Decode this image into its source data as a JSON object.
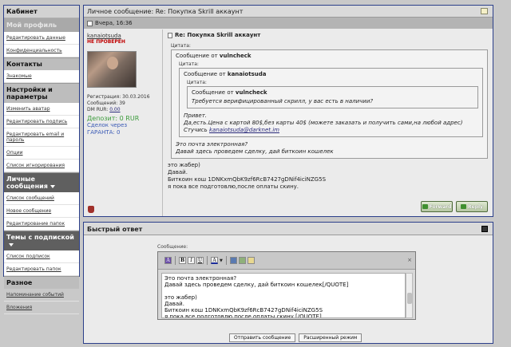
{
  "sidebar": {
    "cabinet": "Кабинет",
    "my_profile": "Мой профиль",
    "items_top": [
      "Редактировать данные",
      "Конфиденциальность"
    ],
    "contacts": "Контакты",
    "contacts_items": [
      "Знакомые"
    ],
    "settings": "Настройки и параметры",
    "settings_items": [
      "Изменить аватар",
      "Редактировать подпись",
      "Редактировать email и пароль",
      "Опции",
      "Список игнорирования"
    ],
    "pm": "Личные сообщения",
    "pm_items": [
      "Список сообщений",
      "Новое сообщение",
      "Редактирование папок"
    ],
    "subs": "Темы с подпиской",
    "subs_items": [
      "Список подписок",
      "Редактировать папок"
    ],
    "misc": "Разное",
    "misc_items": [
      "Напоминание событий",
      "Вложения"
    ]
  },
  "message": {
    "header_label": "Личное сообщение:",
    "header_subject": "Re: Покупка Skrill аккаунт",
    "date": "Вчера, 16:36",
    "author_name": "kanaiotsuda",
    "author_status": "НЕ ПРОВЕРЕН",
    "reg": "Регистрация: 30.03.2016",
    "posts": "Сообщений: 39",
    "dm_label": "DM RUR: ",
    "dm_value": "0.00",
    "deposit": "Депозит: 0 RUR",
    "escrow1": "Сделок через",
    "escrow2": "ГАРАНТА: 0",
    "title": "Re: Покупка Skrill аккаунт",
    "quote_label": "Цитата:",
    "q1_from_prefix": "Сообщение от ",
    "q1_from": "vulncheck",
    "q2_from": "kanaiotsuda",
    "q3_from": "vulncheck",
    "q3_text": "Требуется верифицированный скрилл, у вас есть в наличии?",
    "q2_line1": "Привет.",
    "q2_line2": "Да,есть.Цена с картой 80$,без карты 40$ (можете заказать и получить сами,на любой адрес)",
    "q2_line3_prefix": "Стучись ",
    "q2_link": "kanaiotsuda@darknet.im",
    "q1_line1": "Это почта электронная?",
    "q1_line2": "Давай здесь проведем сделку, дай биткоин кошелек",
    "body_line1": "это жабер)",
    "body_line2": "Давай.",
    "body_line3": "Биткоин кош 1DNKxmQbK9zf6RcB7427gDNif4iciNZG5S",
    "body_line4": "я пока все подготовлю,после оплаты скину.",
    "forward_label": "Forward",
    "reply_label": "Reply"
  },
  "quick_reply": {
    "title": "Быстрый ответ",
    "message_label": "Сообщение:",
    "text": "Это почта электронная?\nДавай здесь проведем сделку, дай биткоин кошелек[/QUOTE]\n\nэто жабер)\nДавай.\nБиткоин кош 1DNKxmQbK9zf6RcB7427gDNif4iciNZG5S\nя пока все подготовлю,после оплаты скину.[/QUOTE]",
    "send_label": "Отправить сообщение",
    "advanced_label": "Расширенный режим",
    "toolbar": {
      "bold": "B",
      "italic": "I",
      "underline": "U",
      "color": "A"
    }
  }
}
